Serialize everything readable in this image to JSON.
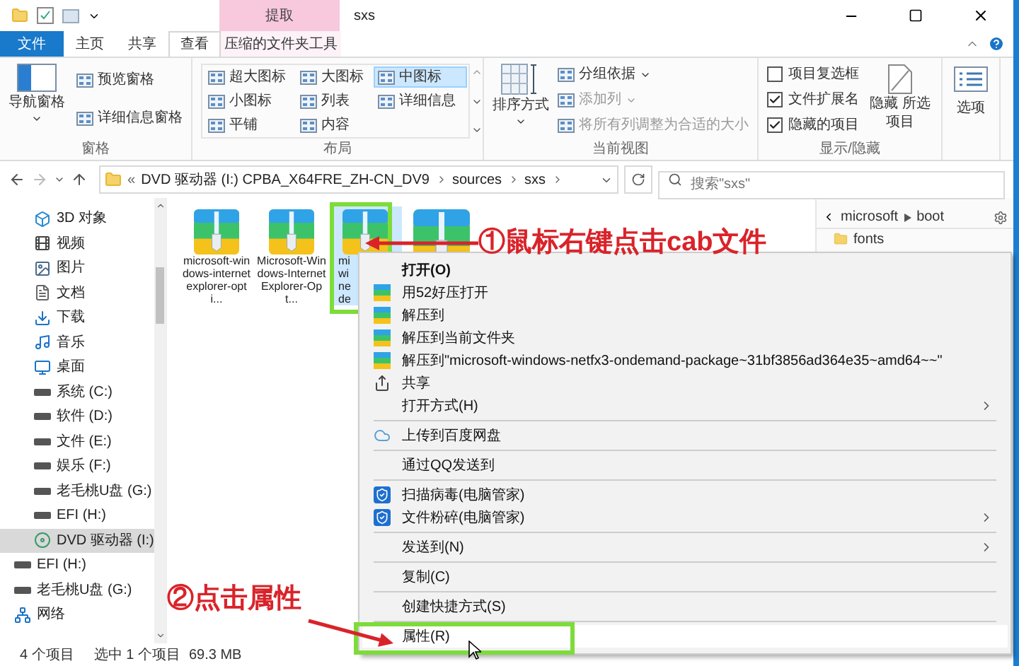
{
  "title_bar": {
    "contextual_label": "提取",
    "title": "sxs"
  },
  "tabs": [
    {
      "label": "文件",
      "kind": "file",
      "selected": false
    },
    {
      "label": "主页",
      "kind": "normal",
      "selected": false
    },
    {
      "label": "共享",
      "kind": "normal",
      "selected": false
    },
    {
      "label": "查看",
      "kind": "normal",
      "selected": true
    },
    {
      "label": "压缩的文件夹工具",
      "kind": "contextual",
      "selected": false
    }
  ],
  "ribbon": {
    "groups": [
      {
        "kind": "panes",
        "label": "窗格",
        "large": {
          "label": "导航窗格"
        },
        "items": [
          {
            "label": "预览窗格"
          },
          {
            "label": "详细信息窗格"
          }
        ]
      },
      {
        "kind": "layout",
        "label": "布局",
        "items": [
          {
            "label": "超大图标",
            "selected": false
          },
          {
            "label": "大图标",
            "selected": false
          },
          {
            "label": "中图标",
            "selected": true
          },
          {
            "label": "小图标",
            "selected": false
          },
          {
            "label": "列表",
            "selected": false
          },
          {
            "label": "详细信息",
            "selected": false
          },
          {
            "label": "平铺",
            "selected": false
          },
          {
            "label": "内容",
            "selected": false
          }
        ]
      },
      {
        "kind": "view",
        "label": "当前视图",
        "large": {
          "label": "排序方式"
        },
        "items": [
          {
            "label": "分组依据",
            "dropdown": true,
            "disabled": false
          },
          {
            "label": "添加列",
            "dropdown": true,
            "disabled": true
          },
          {
            "label": "将所有列调整为合适的大小",
            "dropdown": false,
            "disabled": true
          }
        ]
      },
      {
        "kind": "show_hide",
        "label": "显示/隐藏",
        "checkboxes": [
          {
            "label": "项目复选框",
            "checked": false
          },
          {
            "label": "文件扩展名",
            "checked": true
          },
          {
            "label": "隐藏的项目",
            "checked": true
          }
        ],
        "large": {
          "label": "隐藏 所选项目"
        }
      },
      {
        "kind": "options",
        "large": {
          "label": "选项"
        }
      }
    ]
  },
  "address": {
    "overflow": "«",
    "path": [
      "DVD 驱动器 (I:) CPBA_X64FRE_ZH-CN_DV9",
      "sources",
      "sxs"
    ],
    "search_placeholder": "搜索\"sxs\""
  },
  "nav": [
    {
      "label": "3D 对象",
      "kind": "objects",
      "selected": false
    },
    {
      "label": "视频",
      "kind": "videos",
      "selected": false
    },
    {
      "label": "图片",
      "kind": "pictures",
      "selected": false
    },
    {
      "label": "文档",
      "kind": "documents",
      "selected": false
    },
    {
      "label": "下载",
      "kind": "downloads",
      "selected": false
    },
    {
      "label": "音乐",
      "kind": "music",
      "selected": false
    },
    {
      "label": "桌面",
      "kind": "desktop",
      "selected": false
    },
    {
      "label": "系统 (C:)",
      "kind": "drive",
      "selected": false
    },
    {
      "label": "软件 (D:)",
      "kind": "drive",
      "selected": false
    },
    {
      "label": "文件 (E:)",
      "kind": "drive",
      "selected": false
    },
    {
      "label": "娱乐 (F:)",
      "kind": "drive",
      "selected": false
    },
    {
      "label": "老毛桃U盘 (G:)",
      "kind": "drive",
      "selected": false
    },
    {
      "label": "EFI (H:)",
      "kind": "drive",
      "selected": false
    },
    {
      "label": "DVD 驱动器 (I:)",
      "kind": "dvd",
      "selected": true
    },
    {
      "label": "EFI (H:)",
      "kind": "removable",
      "selected": false
    },
    {
      "label": "老毛桃U盘 (G:)",
      "kind": "removable",
      "selected": false
    },
    {
      "label": "网络",
      "kind": "network",
      "selected": false
    }
  ],
  "files": [
    {
      "name": "microsoft-windows-internetexplorer-opti...",
      "kind": "full",
      "selected": false
    },
    {
      "name": "Microsoft-Windows-InternetExplorer-Opt...",
      "kind": "full",
      "selected": false
    },
    {
      "name": "mi wi ne de",
      "kind": "clipped",
      "selected": true
    },
    {
      "kind": "full",
      "selected": false
    }
  ],
  "side_panel": {
    "path": [
      "microsoft",
      "boot"
    ],
    "items": [
      "fonts"
    ]
  },
  "context_menu": [
    {
      "kind": "plain",
      "label": "打开(O)",
      "bold": true,
      "submenu": false,
      "selected": false
    },
    {
      "kind": "zip",
      "label": "用52好压打开",
      "bold": false,
      "submenu": false,
      "selected": false
    },
    {
      "kind": "zip",
      "label": "解压到",
      "bold": false,
      "submenu": false,
      "selected": false
    },
    {
      "kind": "zip",
      "label": "解压到当前文件夹",
      "bold": false,
      "submenu": false,
      "selected": false
    },
    {
      "kind": "zip",
      "label": "解压到\"microsoft-windows-netfx3-ondemand-package~31bf3856ad364e35~amd64~~\"",
      "bold": false,
      "submenu": false,
      "selected": false
    },
    {
      "kind": "share",
      "label": "共享",
      "bold": false,
      "submenu": false,
      "selected": false
    },
    {
      "kind": "plain",
      "label": "打开方式(H)",
      "bold": false,
      "submenu": true,
      "selected": false
    },
    {
      "kind": "separator"
    },
    {
      "kind": "cloud",
      "label": "上传到百度网盘",
      "bold": false,
      "submenu": false,
      "selected": false
    },
    {
      "kind": "separator"
    },
    {
      "kind": "plain",
      "label": "通过QQ发送到",
      "bold": false,
      "submenu": false,
      "selected": false
    },
    {
      "kind": "separator"
    },
    {
      "kind": "shield",
      "label": "扫描病毒(电脑管家)",
      "bold": false,
      "submenu": false,
      "selected": false
    },
    {
      "kind": "shield",
      "label": "文件粉碎(电脑管家)",
      "bold": false,
      "submenu": true,
      "selected": false
    },
    {
      "kind": "separator"
    },
    {
      "kind": "plain",
      "label": "发送到(N)",
      "bold": false,
      "submenu": true,
      "selected": false
    },
    {
      "kind": "separator"
    },
    {
      "kind": "plain",
      "label": "复制(C)",
      "bold": false,
      "submenu": false,
      "selected": false
    },
    {
      "kind": "separator"
    },
    {
      "kind": "plain",
      "label": "创建快捷方式(S)",
      "bold": false,
      "submenu": false,
      "selected": false
    },
    {
      "kind": "separator"
    },
    {
      "kind": "plain",
      "label": "属性(R)",
      "bold": false,
      "submenu": false,
      "selected": true
    }
  ],
  "annotations": [
    {
      "text": "①鼠标右键点击cab文件"
    },
    {
      "text": "②点击属性"
    }
  ],
  "status_bar": {
    "count": "4 个项目",
    "selection": "选中 1 个项目",
    "size": "69.3 MB"
  }
}
